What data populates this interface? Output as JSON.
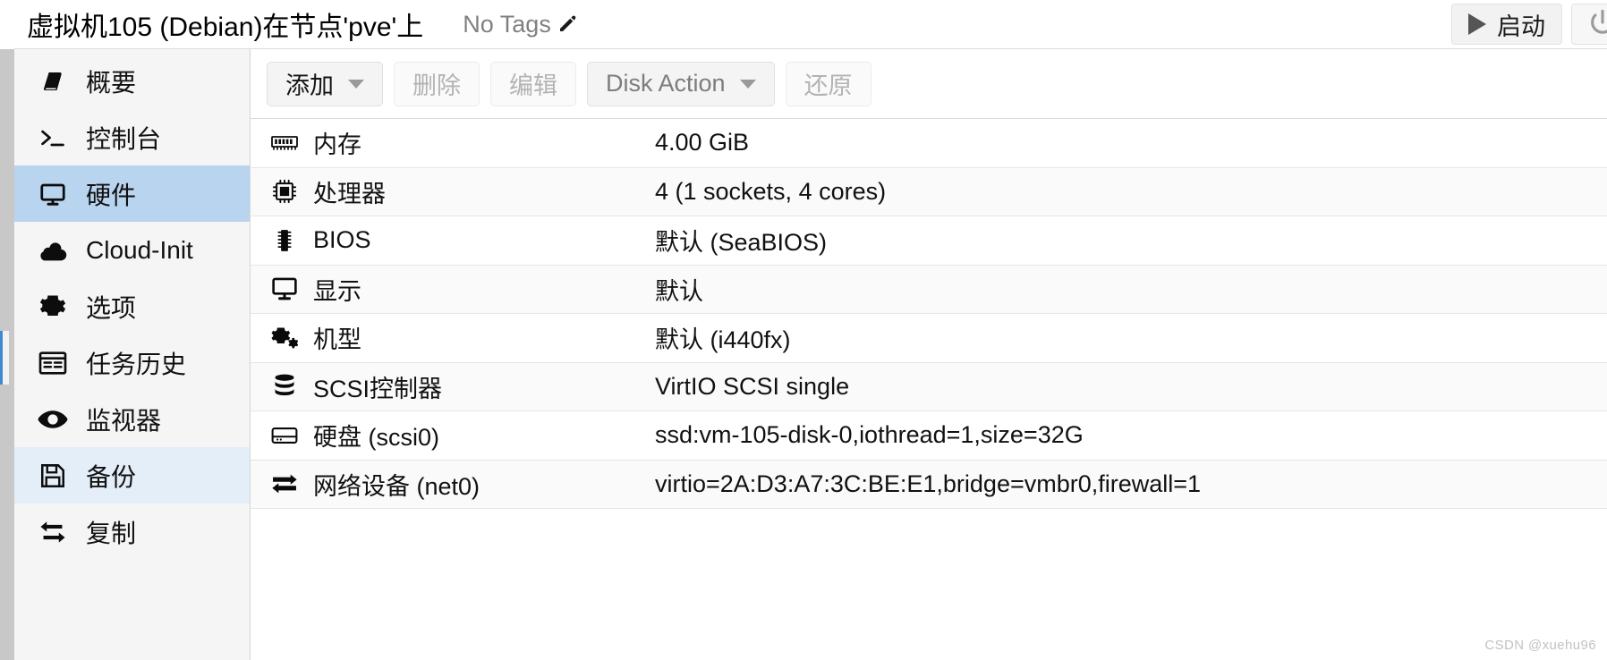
{
  "header": {
    "vm_title": "虚拟机105 (Debian)在节点'pve'上",
    "tags_label": "No Tags",
    "edit_tags_icon": "pencil-icon",
    "start_button": "启动",
    "start_icon": "play-icon",
    "power_icon": "power-icon"
  },
  "sidebar": {
    "items": [
      {
        "label": "概要",
        "icon": "book-icon",
        "state": "normal"
      },
      {
        "label": "控制台",
        "icon": "terminal-icon",
        "state": "normal"
      },
      {
        "label": "硬件",
        "icon": "desktop-icon",
        "state": "selected"
      },
      {
        "label": "Cloud-Init",
        "icon": "cloud-icon",
        "state": "normal"
      },
      {
        "label": "选项",
        "icon": "gear-icon",
        "state": "normal"
      },
      {
        "label": "任务历史",
        "icon": "list-icon",
        "state": "normal"
      },
      {
        "label": "监视器",
        "icon": "eye-icon",
        "state": "normal"
      },
      {
        "label": "备份",
        "icon": "floppy-icon",
        "state": "hovered"
      },
      {
        "label": "复制",
        "icon": "retweet-icon",
        "state": "normal"
      }
    ]
  },
  "toolbar": {
    "buttons": [
      {
        "label": "添加",
        "style": "enabled",
        "caret": true
      },
      {
        "label": "删除",
        "style": "disabled",
        "caret": false
      },
      {
        "label": "编辑",
        "style": "disabled",
        "caret": false
      },
      {
        "label": "Disk Action",
        "style": "muted",
        "caret": true
      },
      {
        "label": "还原",
        "style": "disabled",
        "caret": false
      }
    ]
  },
  "hardware": {
    "rows": [
      {
        "icon": "memory-icon",
        "key": "内存",
        "value": "4.00 GiB"
      },
      {
        "icon": "cpu-icon",
        "key": "处理器",
        "value": "4 (1 sockets, 4 cores)"
      },
      {
        "icon": "chip-icon",
        "key": "BIOS",
        "value": "默认 (SeaBIOS)"
      },
      {
        "icon": "display-icon",
        "key": "显示",
        "value": "默认"
      },
      {
        "icon": "cogs-icon",
        "key": "机型",
        "value": "默认 (i440fx)"
      },
      {
        "icon": "database-icon",
        "key": "SCSI控制器",
        "value": "VirtIO SCSI single"
      },
      {
        "icon": "harddisk-icon",
        "key": "硬盘 (scsi0)",
        "value": "ssd:vm-105-disk-0,iothread=1,size=32G"
      },
      {
        "icon": "exchange-icon",
        "key": "网络设备 (net0)",
        "value": "virtio=2A:D3:A7:3C:BE:E1,bridge=vmbr0,firewall=1"
      }
    ]
  },
  "watermark": "CSDN @xuehu96",
  "colors": {
    "selected_item": "#b8d4ee",
    "hovered_item": "#e3eef9",
    "sidebar_bg": "#f5f5f5",
    "row_stripe": "#fafafa",
    "accent": "#3e8ad2"
  }
}
